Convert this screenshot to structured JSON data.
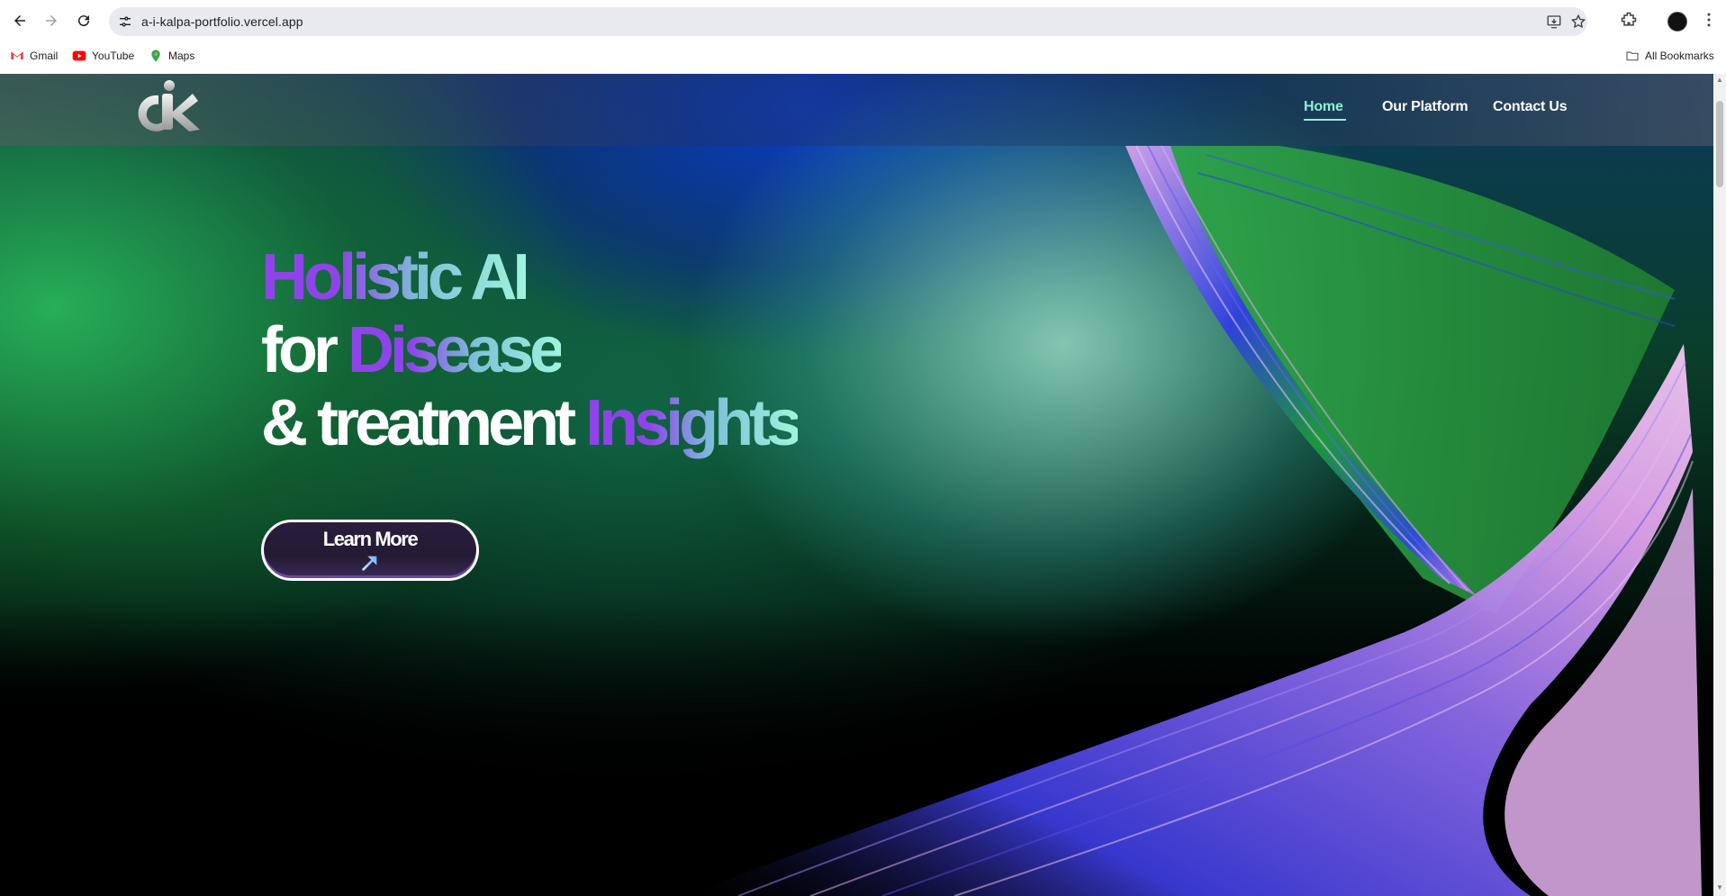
{
  "browser": {
    "url": "a-i-kalpa-portfolio.vercel.app",
    "bookmarks": [
      {
        "label": "Gmail",
        "icon": "gmail-icon"
      },
      {
        "label": "YouTube",
        "icon": "youtube-icon"
      },
      {
        "label": "Maps",
        "icon": "maps-icon"
      }
    ],
    "all_bookmarks_label": "All Bookmarks"
  },
  "site": {
    "nav": {
      "home": "Home",
      "platform": "Our Platform",
      "contact": "Contact Us",
      "active": "home"
    },
    "hero": {
      "line1_gradient": "Holistic AI",
      "line2_plain": "for ",
      "line2_gradient": "Disease",
      "line3_plain": "& treatment ",
      "line3_gradient": "Insights",
      "cta_label": "Learn More",
      "cta_icon": "arrow-up-right-icon"
    },
    "colors": {
      "accent_purple": "#8e44e8",
      "accent_mint": "#9ff5dc",
      "active_nav": "#8ff0d6"
    }
  }
}
